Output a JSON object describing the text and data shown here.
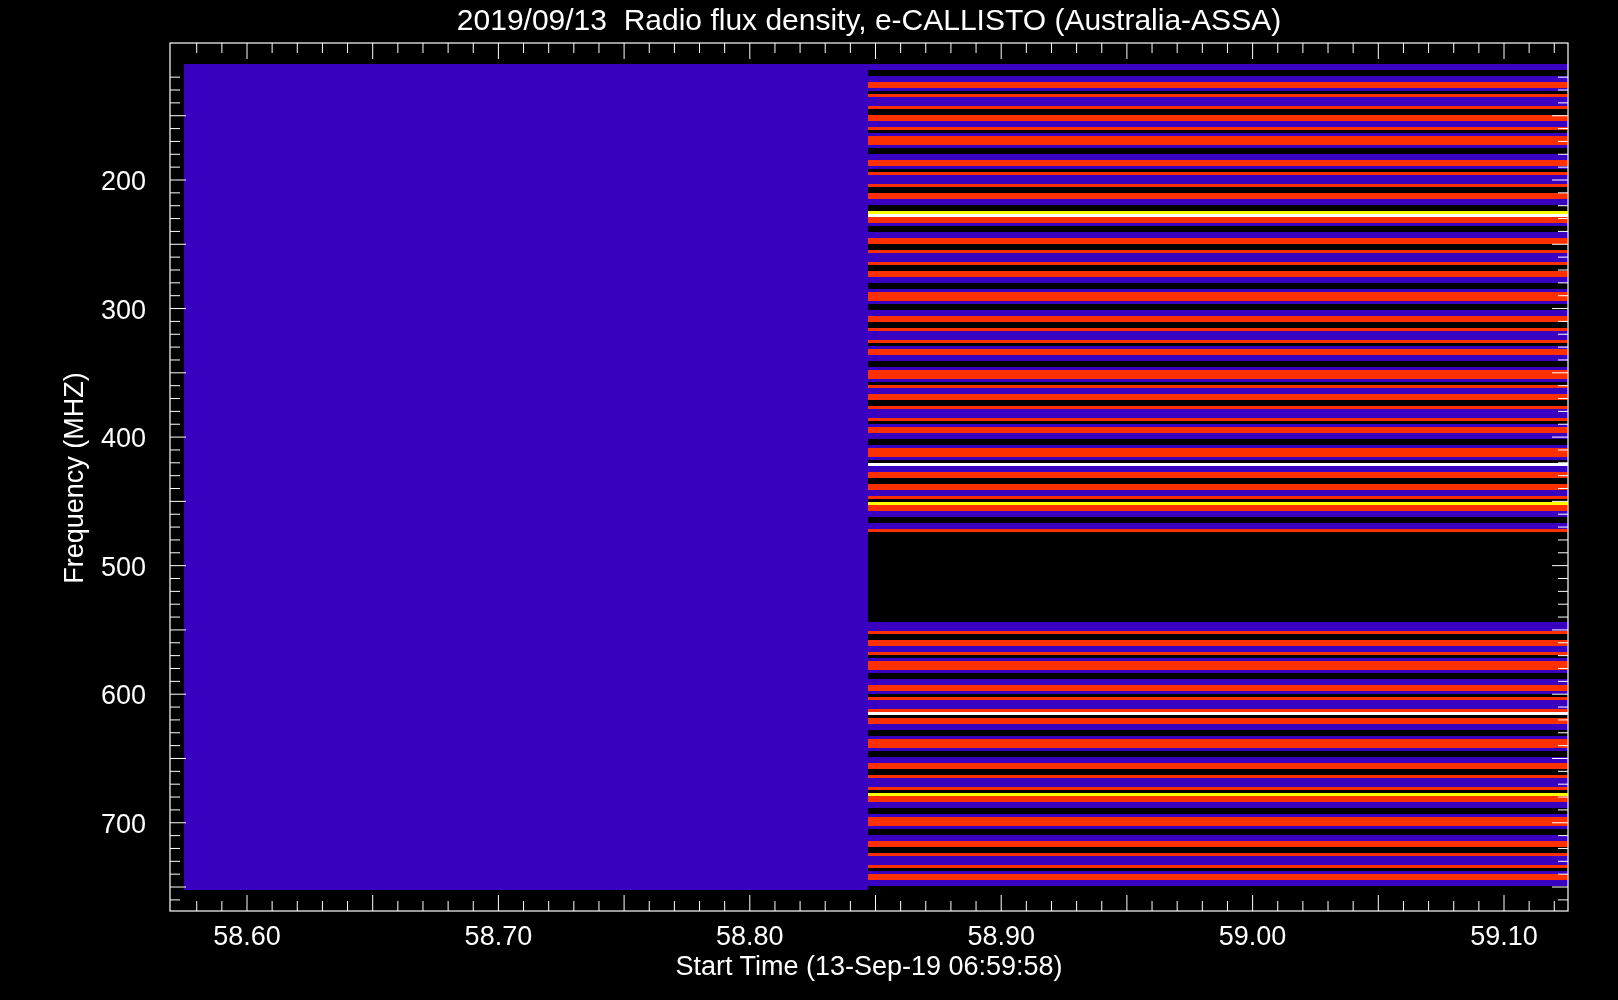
{
  "plot": {
    "title": "2019/09/13  Radio flux density, e-CALLISTO (Australia-ASSA)",
    "xlabel": "Start Time (13-Sep-19 06:59:58)",
    "ylabel": "Frequency (MHZ)",
    "xticks": [
      "58.60",
      "58.70",
      "58.80",
      "58.90",
      "59.00",
      "59.10"
    ],
    "yticks": [
      "200",
      "300",
      "400",
      "500",
      "600",
      "700"
    ]
  }
}
